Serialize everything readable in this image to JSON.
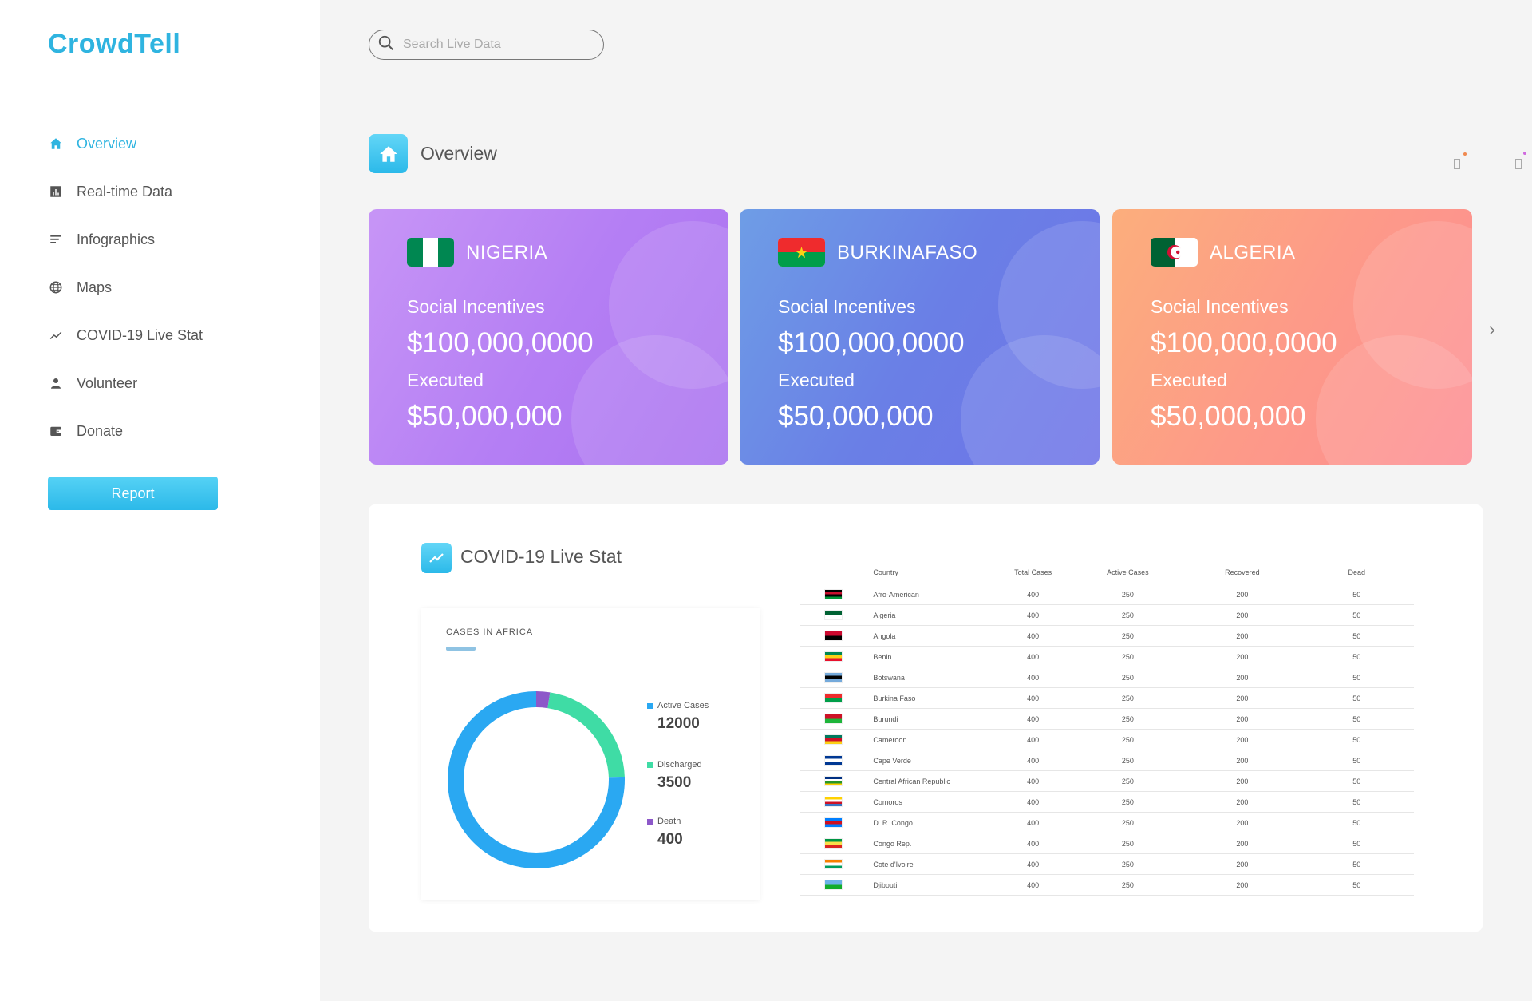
{
  "app": {
    "name": "CrowdTell"
  },
  "sidebar": {
    "items": [
      {
        "label": "Overview",
        "icon": "home-icon",
        "active": true
      },
      {
        "label": "Real-time Data",
        "icon": "bar-chart-icon"
      },
      {
        "label": "Infographics",
        "icon": "lines-icon"
      },
      {
        "label": "Maps",
        "icon": "globe-icon"
      },
      {
        "label": "COVID-19 Live Stat",
        "icon": "trend-icon"
      },
      {
        "label": "Volunteer",
        "icon": "person-icon"
      },
      {
        "label": "Donate",
        "icon": "wallet-icon"
      }
    ],
    "report_label": "Report"
  },
  "search": {
    "placeholder": "Search Live Data"
  },
  "overview": {
    "title": "Overview"
  },
  "cards": [
    {
      "country": "NIGERIA",
      "label1": "Social Incentives",
      "amount1": "$100,000,0000",
      "label2": "Executed",
      "amount2": "$50,000,000"
    },
    {
      "country": "BURKINAFASO",
      "label1": "Social Incentives",
      "amount1": "$100,000,0000",
      "label2": "Executed",
      "amount2": "$50,000,000"
    },
    {
      "country": "ALGERIA",
      "label1": "Social Incentives",
      "amount1": "$100,000,0000",
      "label2": "Executed",
      "amount2": "$50,000,000"
    }
  ],
  "stat": {
    "title": "COVID-19 Live Stat",
    "donut_title": "CASES IN AFRICA",
    "legend": [
      {
        "label": "Active Cases",
        "value": "12000",
        "color": "#2aa8f2"
      },
      {
        "label": "Discharged",
        "value": "3500",
        "color": "#3fdca5"
      },
      {
        "label": "Death",
        "value": "400",
        "color": "#8d58c9"
      }
    ]
  },
  "chart_data": {
    "type": "pie",
    "title": "CASES IN AFRICA",
    "categories": [
      "Active Cases",
      "Discharged",
      "Death"
    ],
    "values": [
      12000,
      3500,
      400
    ],
    "colors": [
      "#2aa8f2",
      "#3fdca5",
      "#8d58c9"
    ]
  },
  "table": {
    "headers": [
      "Country",
      "Total Cases",
      "Active Cases",
      "Recovered",
      "Dead"
    ],
    "rows": [
      {
        "country": "Afro-American",
        "total": "400",
        "active": "250",
        "recovered": "200",
        "dead": "50",
        "flag": [
          "#000000",
          "#c8102e",
          "#000000",
          "#009639"
        ]
      },
      {
        "country": "Algeria",
        "total": "400",
        "active": "250",
        "recovered": "200",
        "dead": "50",
        "flag": [
          "#006233",
          "#ffffff"
        ]
      },
      {
        "country": "Angola",
        "total": "400",
        "active": "250",
        "recovered": "200",
        "dead": "50",
        "flag": [
          "#cc092f",
          "#000000"
        ]
      },
      {
        "country": "Benin",
        "total": "400",
        "active": "250",
        "recovered": "200",
        "dead": "50",
        "flag": [
          "#008751",
          "#fcd116",
          "#e8112d"
        ]
      },
      {
        "country": "Botswana",
        "total": "400",
        "active": "250",
        "recovered": "200",
        "dead": "50",
        "flag": [
          "#75aadb",
          "#000000",
          "#75aadb"
        ]
      },
      {
        "country": "Burkina Faso",
        "total": "400",
        "active": "250",
        "recovered": "200",
        "dead": "50",
        "flag": [
          "#ef2b2d",
          "#009e49"
        ]
      },
      {
        "country": "Burundi",
        "total": "400",
        "active": "250",
        "recovered": "200",
        "dead": "50",
        "flag": [
          "#ce1126",
          "#1eb53a"
        ]
      },
      {
        "country": "Cameroon",
        "total": "400",
        "active": "250",
        "recovered": "200",
        "dead": "50",
        "flag": [
          "#007a5e",
          "#ce1126",
          "#fcd116"
        ]
      },
      {
        "country": "Cape Verde",
        "total": "400",
        "active": "250",
        "recovered": "200",
        "dead": "50",
        "flag": [
          "#003893",
          "#ffffff",
          "#003893"
        ]
      },
      {
        "country": "Central African Republic",
        "total": "400",
        "active": "250",
        "recovered": "200",
        "dead": "50",
        "flag": [
          "#003082",
          "#ffffff",
          "#289728",
          "#ffce00"
        ]
      },
      {
        "country": "Comoros",
        "total": "400",
        "active": "250",
        "recovered": "200",
        "dead": "50",
        "flag": [
          "#ffd100",
          "#ffffff",
          "#ce1126",
          "#3a75c4"
        ]
      },
      {
        "country": "D. R. Congo.",
        "total": "400",
        "active": "250",
        "recovered": "200",
        "dead": "50",
        "flag": [
          "#007fff",
          "#ce1021",
          "#007fff"
        ]
      },
      {
        "country": "Congo Rep.",
        "total": "400",
        "active": "250",
        "recovered": "200",
        "dead": "50",
        "flag": [
          "#009543",
          "#fbde4a",
          "#dc241f"
        ]
      },
      {
        "country": "Cote d'Ivoire",
        "total": "400",
        "active": "250",
        "recovered": "200",
        "dead": "50",
        "flag": [
          "#f77f00",
          "#ffffff",
          "#009e60"
        ]
      },
      {
        "country": "Djibouti",
        "total": "400",
        "active": "250",
        "recovered": "200",
        "dead": "50",
        "flag": [
          "#6ab2e7",
          "#12ad2b"
        ]
      }
    ]
  }
}
